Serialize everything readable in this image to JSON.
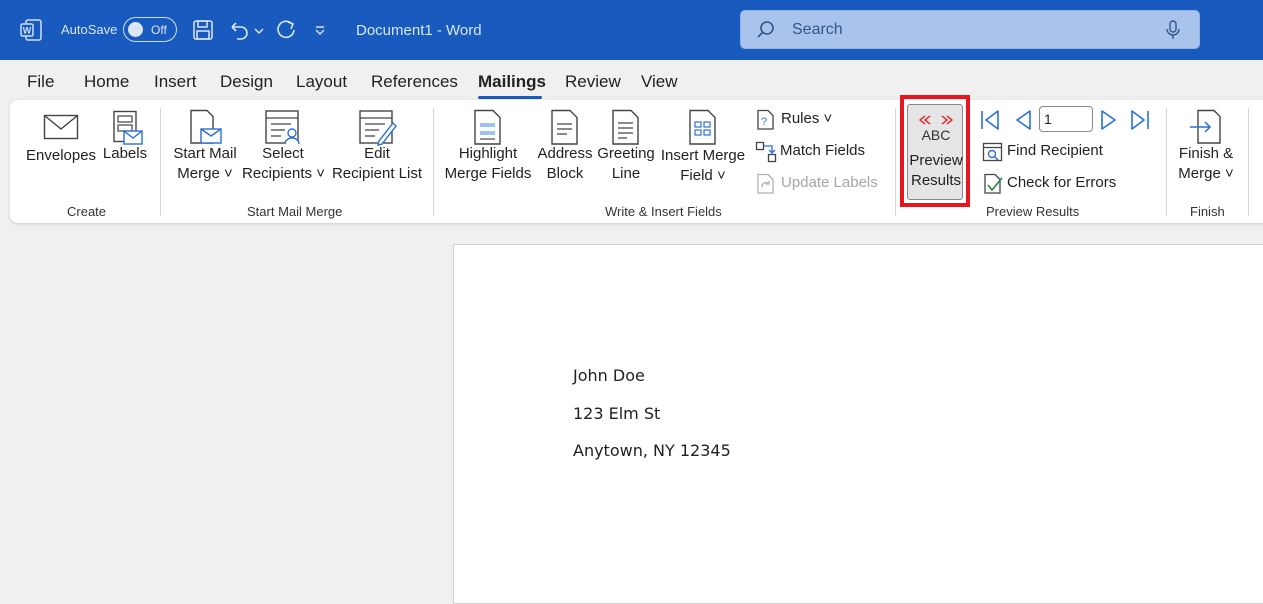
{
  "titlebar": {
    "autosave_label": "AutoSave",
    "autosave_state": "Off",
    "document_title": "Document1  -  Word",
    "search_placeholder": "Search"
  },
  "menu": {
    "tabs": [
      {
        "label": "File"
      },
      {
        "label": "Home"
      },
      {
        "label": "Insert"
      },
      {
        "label": "Design"
      },
      {
        "label": "Layout"
      },
      {
        "label": "References"
      },
      {
        "label": "Mailings",
        "active": true
      },
      {
        "label": "Review"
      },
      {
        "label": "View"
      }
    ]
  },
  "ribbon": {
    "create": {
      "group_label": "Create",
      "envelopes": "Envelopes",
      "labels": "Labels"
    },
    "start_mail_merge": {
      "group_label": "Start Mail Merge",
      "start_line1": "Start Mail",
      "start_line2": "Merge",
      "select_line1": "Select",
      "select_line2": "Recipients",
      "edit_line1": "Edit",
      "edit_line2": "Recipient List"
    },
    "write_insert": {
      "group_label": "Write & Insert Fields",
      "highlight_line1": "Highlight",
      "highlight_line2": "Merge Fields",
      "address_line1": "Address",
      "address_line2": "Block",
      "greeting_line1": "Greeting",
      "greeting_line2": "Line",
      "insert_line1": "Insert Merge",
      "insert_line2": "Field",
      "rules": "Rules",
      "match_fields": "Match Fields",
      "update_labels": "Update Labels"
    },
    "preview": {
      "group_label": "Preview Results",
      "abc": "ABC",
      "preview_line1": "Preview",
      "preview_line2": "Results",
      "record_value": "1",
      "find_recipient": "Find Recipient",
      "check_errors": "Check for Errors"
    },
    "finish": {
      "group_label": "Finish",
      "finish_line1": "Finish &",
      "finish_line2": "Merge"
    }
  },
  "document": {
    "lines": [
      "John Doe",
      "123 Elm St",
      "Anytown, NY 12345"
    ]
  },
  "colors": {
    "titlebar": "#185abd",
    "highlight": "#e8141e",
    "accent": "#2b6fd6"
  }
}
